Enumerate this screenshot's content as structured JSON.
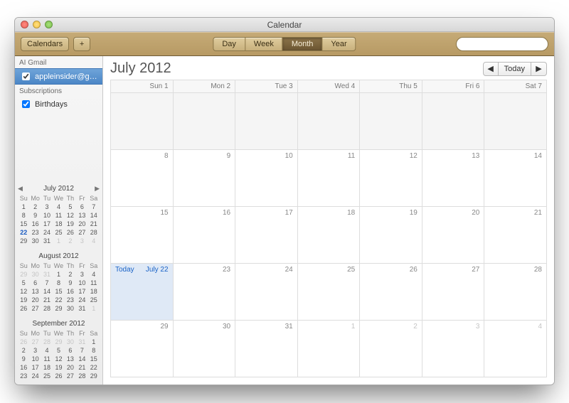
{
  "window_title": "Calendar",
  "toolbar": {
    "calendars_label": "Calendars",
    "add_label": "+",
    "views": [
      "Day",
      "Week",
      "Month",
      "Year"
    ],
    "active_view": "Month",
    "search_placeholder": ""
  },
  "sidebar": {
    "sections": [
      {
        "header": "AI Gmail",
        "items": [
          {
            "label": "appleinsider@gm...",
            "checked": true,
            "selected": true
          }
        ]
      },
      {
        "header": "Subscriptions",
        "items": [
          {
            "label": "Birthdays",
            "checked": true,
            "selected": false
          }
        ]
      }
    ]
  },
  "minicals": [
    {
      "title": "July 2012",
      "navs": true,
      "dow": [
        "Su",
        "Mo",
        "Tu",
        "We",
        "Th",
        "Fr",
        "Sa"
      ],
      "weeks": [
        [
          {
            "n": 1
          },
          {
            "n": 2
          },
          {
            "n": 3
          },
          {
            "n": 4
          },
          {
            "n": 5
          },
          {
            "n": 6
          },
          {
            "n": 7
          }
        ],
        [
          {
            "n": 8
          },
          {
            "n": 9
          },
          {
            "n": 10
          },
          {
            "n": 11
          },
          {
            "n": 12
          },
          {
            "n": 13
          },
          {
            "n": 14
          }
        ],
        [
          {
            "n": 15
          },
          {
            "n": 16
          },
          {
            "n": 17
          },
          {
            "n": 18
          },
          {
            "n": 19
          },
          {
            "n": 20
          },
          {
            "n": 21
          }
        ],
        [
          {
            "n": 22,
            "today": true
          },
          {
            "n": 23
          },
          {
            "n": 24
          },
          {
            "n": 25
          },
          {
            "n": 26
          },
          {
            "n": 27
          },
          {
            "n": 28
          }
        ],
        [
          {
            "n": 29
          },
          {
            "n": 30
          },
          {
            "n": 31
          },
          {
            "n": 1,
            "dim": true
          },
          {
            "n": 2,
            "dim": true
          },
          {
            "n": 3,
            "dim": true
          },
          {
            "n": 4,
            "dim": true
          }
        ]
      ]
    },
    {
      "title": "August 2012",
      "navs": false,
      "dow": [
        "Su",
        "Mo",
        "Tu",
        "We",
        "Th",
        "Fr",
        "Sa"
      ],
      "weeks": [
        [
          {
            "n": 29,
            "dim": true
          },
          {
            "n": 30,
            "dim": true
          },
          {
            "n": 31,
            "dim": true
          },
          {
            "n": 1
          },
          {
            "n": 2
          },
          {
            "n": 3
          },
          {
            "n": 4
          }
        ],
        [
          {
            "n": 5
          },
          {
            "n": 6
          },
          {
            "n": 7
          },
          {
            "n": 8
          },
          {
            "n": 9
          },
          {
            "n": 10
          },
          {
            "n": 11
          }
        ],
        [
          {
            "n": 12
          },
          {
            "n": 13
          },
          {
            "n": 14
          },
          {
            "n": 15
          },
          {
            "n": 16
          },
          {
            "n": 17
          },
          {
            "n": 18
          }
        ],
        [
          {
            "n": 19
          },
          {
            "n": 20
          },
          {
            "n": 21
          },
          {
            "n": 22
          },
          {
            "n": 23
          },
          {
            "n": 24
          },
          {
            "n": 25
          }
        ],
        [
          {
            "n": 26
          },
          {
            "n": 27
          },
          {
            "n": 28
          },
          {
            "n": 29
          },
          {
            "n": 30
          },
          {
            "n": 31
          },
          {
            "n": 1,
            "dim": true
          }
        ]
      ]
    },
    {
      "title": "September 2012",
      "navs": false,
      "dow": [
        "Su",
        "Mo",
        "Tu",
        "We",
        "Th",
        "Fr",
        "Sa"
      ],
      "weeks": [
        [
          {
            "n": 26,
            "dim": true
          },
          {
            "n": 27,
            "dim": true
          },
          {
            "n": 28,
            "dim": true
          },
          {
            "n": 29,
            "dim": true
          },
          {
            "n": 30,
            "dim": true
          },
          {
            "n": 31,
            "dim": true
          },
          {
            "n": 1
          }
        ],
        [
          {
            "n": 2
          },
          {
            "n": 3
          },
          {
            "n": 4
          },
          {
            "n": 5
          },
          {
            "n": 6
          },
          {
            "n": 7
          },
          {
            "n": 8
          }
        ],
        [
          {
            "n": 9
          },
          {
            "n": 10
          },
          {
            "n": 11
          },
          {
            "n": 12
          },
          {
            "n": 13
          },
          {
            "n": 14
          },
          {
            "n": 15
          }
        ],
        [
          {
            "n": 16
          },
          {
            "n": 17
          },
          {
            "n": 18
          },
          {
            "n": 19
          },
          {
            "n": 20
          },
          {
            "n": 21
          },
          {
            "n": 22
          }
        ],
        [
          {
            "n": 23
          },
          {
            "n": 24
          },
          {
            "n": 25
          },
          {
            "n": 26
          },
          {
            "n": 27
          },
          {
            "n": 28
          },
          {
            "n": 29
          }
        ]
      ]
    }
  ],
  "main": {
    "title": "July 2012",
    "today_button": "Today",
    "today_cell_label": "Today",
    "headers": [
      "Sun 1",
      "Mon 2",
      "Tue 3",
      "Wed 4",
      "Thu 5",
      "Fri 6",
      "Sat 7"
    ],
    "weeks": [
      [
        {
          "n": 8
        },
        {
          "n": 9
        },
        {
          "n": 10
        },
        {
          "n": 11
        },
        {
          "n": 12
        },
        {
          "n": 13
        },
        {
          "n": 14
        }
      ],
      [
        {
          "n": 15
        },
        {
          "n": 16
        },
        {
          "n": 17
        },
        {
          "n": 18
        },
        {
          "n": 19
        },
        {
          "n": 20
        },
        {
          "n": 21
        }
      ],
      [
        {
          "n": "July 22",
          "today": true
        },
        {
          "n": 23
        },
        {
          "n": 24
        },
        {
          "n": 25
        },
        {
          "n": 26
        },
        {
          "n": 27
        },
        {
          "n": 28
        }
      ],
      [
        {
          "n": 29
        },
        {
          "n": 30
        },
        {
          "n": 31
        },
        {
          "n": 1,
          "dim": true
        },
        {
          "n": 2,
          "dim": true
        },
        {
          "n": 3,
          "dim": true
        },
        {
          "n": 4,
          "dim": true
        }
      ]
    ]
  }
}
